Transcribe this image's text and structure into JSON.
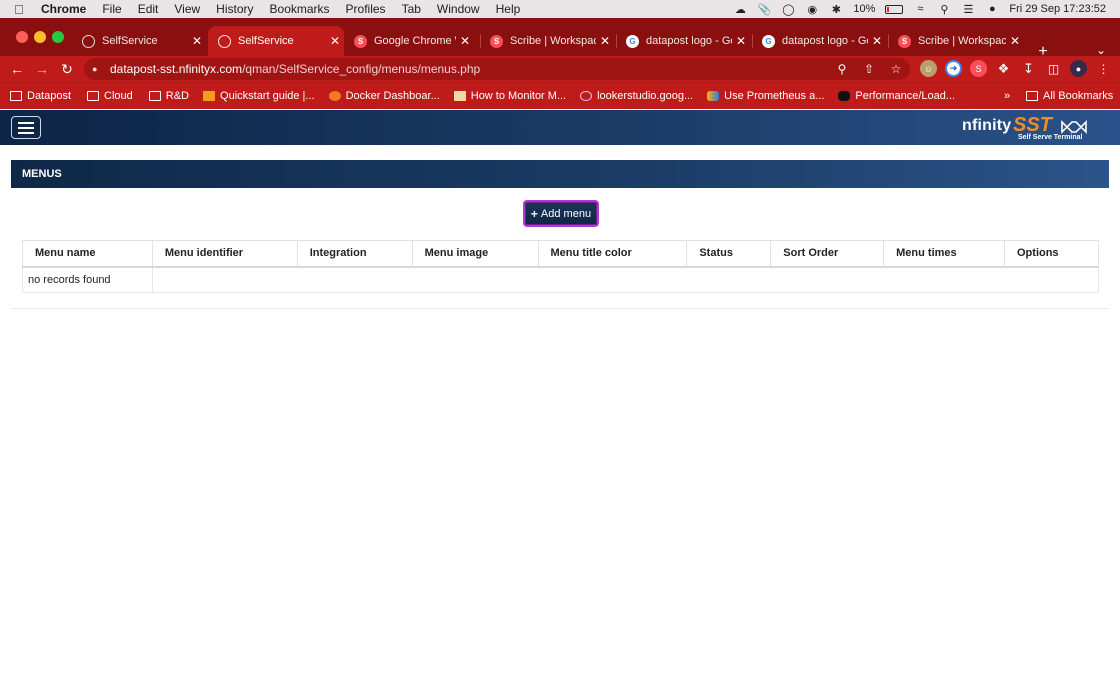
{
  "macbar": {
    "app_name": "Chrome",
    "menus": [
      "File",
      "Edit",
      "View",
      "History",
      "Bookmarks",
      "Profiles",
      "Tab",
      "Window",
      "Help"
    ],
    "battery": "10%",
    "datetime": "Fri 29 Sep  17:23:52"
  },
  "tabs": [
    {
      "title": "SelfService",
      "favicon": "globe-icon",
      "active": false
    },
    {
      "title": "SelfService",
      "favicon": "globe-icon",
      "active": true
    },
    {
      "title": "Google Chrome W",
      "favicon": "scribe-icon",
      "active": false
    },
    {
      "title": "Scribe | Workspace",
      "favicon": "scribe-icon",
      "active": false
    },
    {
      "title": "datapost logo - Go",
      "favicon": "google-icon",
      "active": false
    },
    {
      "title": "datapost logo - Go",
      "favicon": "google-icon",
      "active": false
    },
    {
      "title": "Scribe | Workspace",
      "favicon": "scribe-icon",
      "active": false
    }
  ],
  "address_bar": {
    "host": "datapost-sst.nfinityx.com",
    "path": "/qman/SelfService_config/menus/menus.php"
  },
  "bookmarks": [
    {
      "label": "Datapost",
      "icon": "folder-icon"
    },
    {
      "label": "Cloud",
      "icon": "folder-icon"
    },
    {
      "label": "R&D",
      "icon": "folder-icon"
    },
    {
      "label": "Quickstart guide |...",
      "icon": "quickstart-icon"
    },
    {
      "label": "Docker Dashboar...",
      "icon": "grafana-icon"
    },
    {
      "label": "How to Monitor M...",
      "icon": "monitor-icon"
    },
    {
      "label": "lookerstudio.goog...",
      "icon": "looker-icon"
    },
    {
      "label": "Use Prometheus a...",
      "icon": "prometheus-icon"
    },
    {
      "label": "Performance/Load...",
      "icon": "medium-icon"
    }
  ],
  "bookmarks_more": "»",
  "bookmarks_all": "All Bookmarks",
  "app": {
    "logo_word": "nfinity",
    "logo_sst": "SST",
    "logo_tagline": "Self Serve Terminal"
  },
  "page": {
    "panel_title": "MENUS",
    "add_button_label": "Add menu",
    "columns": [
      "Menu name",
      "Menu identifier",
      "Integration",
      "Menu image",
      "Menu title color",
      "Status",
      "Sort Order",
      "Menu times",
      "Options"
    ],
    "empty_message": "no records found"
  },
  "colors": {
    "chrome_frame": "#8a1010",
    "chrome_toolbar": "#c01b1b",
    "app_navy": "#0d2546",
    "button_border": "#b238d4"
  }
}
